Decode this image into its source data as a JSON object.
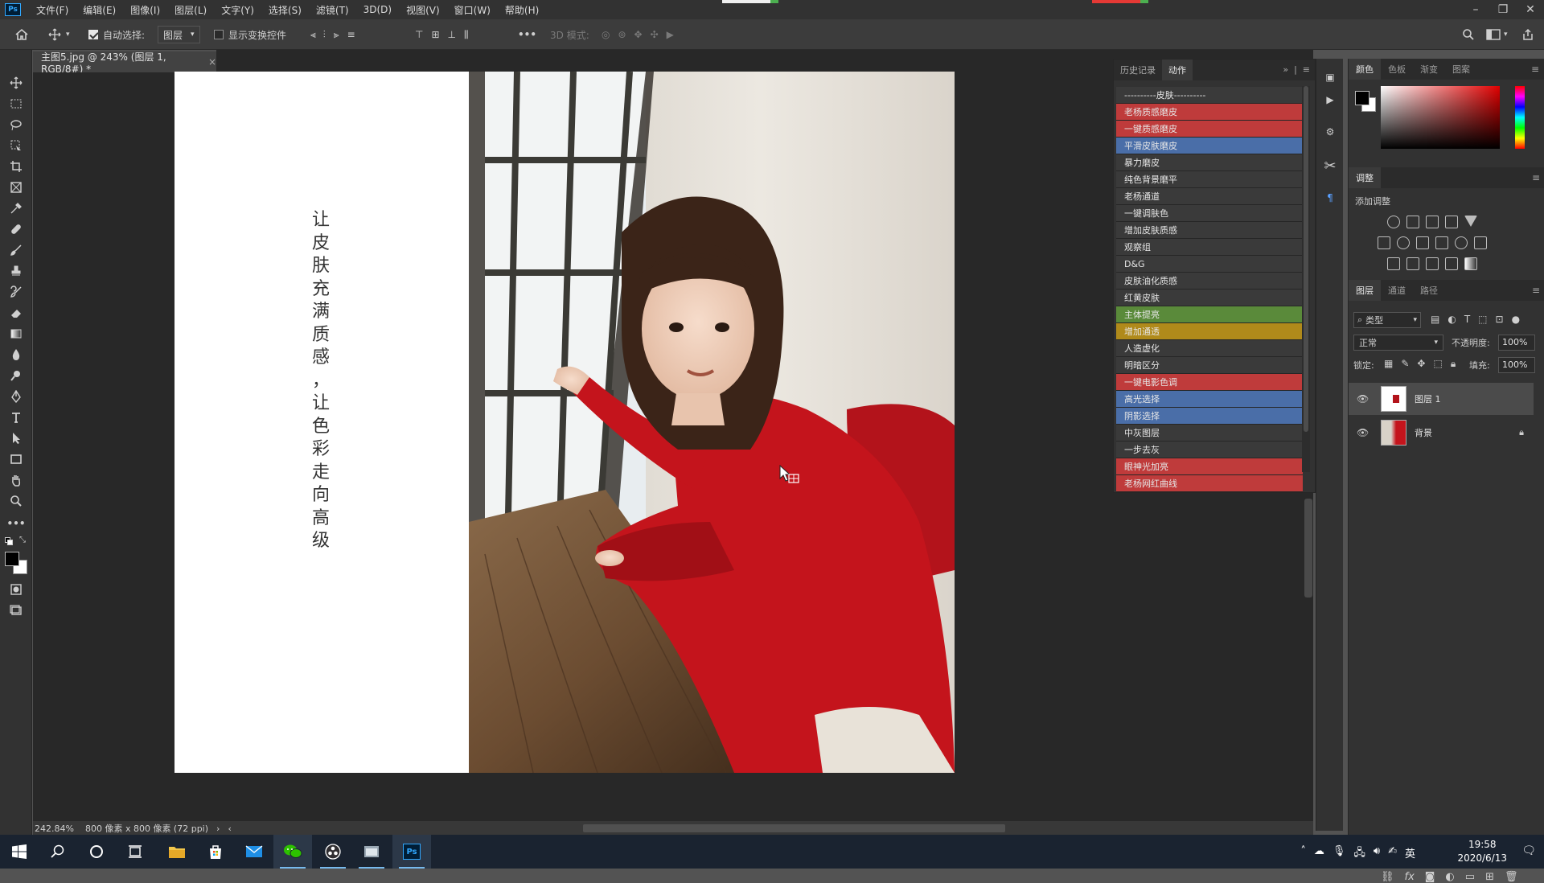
{
  "app": {
    "logo": "Ps",
    "menus": [
      "文件(F)",
      "编辑(E)",
      "图像(I)",
      "图层(L)",
      "文字(Y)",
      "选择(S)",
      "滤镜(T)",
      "3D(D)",
      "视图(V)",
      "窗口(W)",
      "帮助(H)"
    ]
  },
  "options": {
    "auto_select_label": "自动选择:",
    "auto_select_value": "图层",
    "show_transform_label": "显示变换控件",
    "mode_3d_label": "3D 模式:",
    "more": "•••"
  },
  "document": {
    "tab_title": "主图5.jpg @ 243% (图层 1, RGB/8#) *",
    "tab_close": "×",
    "vertical_text": [
      "让",
      "皮",
      "肤",
      "充",
      "满",
      "质",
      "感",
      "，",
      "让",
      "色",
      "彩",
      "走",
      "向",
      "高",
      "级"
    ],
    "zoom": "242.84%",
    "doc_info": "800 像素 x 800 像素 (72 ppi)"
  },
  "actions_panel": {
    "tabs": [
      "历史记录",
      "动作"
    ],
    "active_tab": "动作",
    "items": [
      {
        "label": "----------皮肤----------",
        "color": "#3a3a3a"
      },
      {
        "label": "老杨质感磨皮",
        "color": "#bf3b3b"
      },
      {
        "label": "一键质感磨皮",
        "color": "#bf3b3b"
      },
      {
        "label": "平滑皮肤磨皮",
        "color": "#4a6ea8"
      },
      {
        "label": "暴力磨皮",
        "color": "#3a3a3a"
      },
      {
        "label": "纯色背景磨平",
        "color": "#3a3a3a"
      },
      {
        "label": "老杨通道",
        "color": "#3a3a3a"
      },
      {
        "label": "一键调肤色",
        "color": "#3a3a3a"
      },
      {
        "label": "增加皮肤质感",
        "color": "#3a3a3a"
      },
      {
        "label": "观察组",
        "color": "#3a3a3a"
      },
      {
        "label": "D&G",
        "color": "#3a3a3a"
      },
      {
        "label": "皮肤油化质感",
        "color": "#3a3a3a"
      },
      {
        "label": "红黄皮肤",
        "color": "#3a3a3a"
      },
      {
        "label": "主体提亮",
        "color": "#5a8a3a"
      },
      {
        "label": "增加通透",
        "color": "#b08a1a"
      },
      {
        "label": "人造虚化",
        "color": "#3a3a3a"
      },
      {
        "label": "明暗区分",
        "color": "#3a3a3a"
      },
      {
        "label": "一键电影色调",
        "color": "#bf3b3b"
      },
      {
        "label": "高光选择",
        "color": "#4a6ea8"
      },
      {
        "label": "阴影选择",
        "color": "#4a6ea8"
      },
      {
        "label": "中灰图层",
        "color": "#3a3a3a"
      },
      {
        "label": "一步去灰",
        "color": "#3a3a3a"
      },
      {
        "label": "眼神光加亮",
        "color": "#bf3b3b"
      },
      {
        "label": "老杨网红曲线",
        "color": "#bf3b3b"
      }
    ]
  },
  "color_panel": {
    "tabs": [
      "颜色",
      "色板",
      "渐变",
      "图案"
    ],
    "active_tab": "颜色"
  },
  "adjust_panel": {
    "title": "调整",
    "subtitle": "添加调整"
  },
  "layers_panel": {
    "tabs": [
      "图层",
      "通道",
      "路径"
    ],
    "active_tab": "图层",
    "filter_label": "类型",
    "blend_mode": "正常",
    "opacity_label": "不透明度:",
    "opacity_value": "100%",
    "lock_label": "锁定:",
    "fill_label": "填充:",
    "fill_value": "100%",
    "layers": [
      {
        "name": "图层 1",
        "selected": true
      },
      {
        "name": "背景",
        "selected": false,
        "locked": true
      }
    ]
  },
  "taskbar": {
    "time": "19:58",
    "date": "2020/6/13",
    "ime": "英"
  }
}
